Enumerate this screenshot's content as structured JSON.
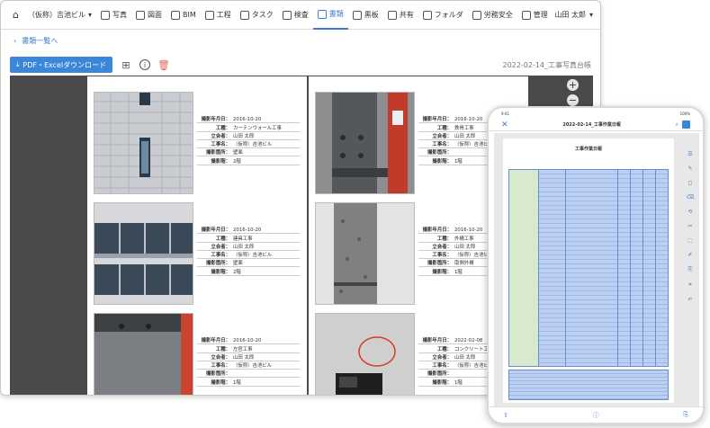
{
  "nav": {
    "project": "（仮称）吉池ビル",
    "items": [
      {
        "label": "写真"
      },
      {
        "label": "図面"
      },
      {
        "label": "BIM"
      },
      {
        "label": "工程"
      },
      {
        "label": "タスク"
      },
      {
        "label": "検査"
      },
      {
        "label": "書類"
      },
      {
        "label": "黒板"
      },
      {
        "label": "共有"
      },
      {
        "label": "フォルダ"
      },
      {
        "label": "労務安全"
      },
      {
        "label": "管理"
      }
    ],
    "user": "山田 太郎"
  },
  "breadcrumb": "書類一覧へ",
  "toolbar": {
    "download_label": "PDF・Excelダウンロード",
    "doc_title": "2022-02-14_工事写真台帳"
  },
  "entries_left": [
    {
      "date_k": "撮影年月日：",
      "date": "2016-10-20",
      "work_k": "工種：",
      "work": "カーテンウォール工事",
      "witness_k": "立会者：",
      "witness": "山田 太郎",
      "name_k": "工事名：",
      "name": "（仮称）吉池ビル",
      "place_k": "撮影箇所：",
      "place": "壁面",
      "floor_k": "撮影階：",
      "floor": "2階"
    },
    {
      "date_k": "撮影年月日：",
      "date": "2016-10-20",
      "work_k": "工種：",
      "work": "建具工事",
      "witness_k": "立会者：",
      "witness": "山田 太郎",
      "name_k": "工事名：",
      "name": "（仮称）吉池ビル",
      "place_k": "撮影箇所：",
      "place": "壁面",
      "floor_k": "撮影階：",
      "floor": "2階"
    },
    {
      "date_k": "撮影年月日：",
      "date": "2016-10-20",
      "work_k": "工種：",
      "work": "左官工事",
      "witness_k": "立会者：",
      "witness": "山田 太郎",
      "name_k": "工事名：",
      "name": "（仮称）吉池ビル",
      "place_k": "撮影箇所：",
      "place": "",
      "floor_k": "撮影階：",
      "floor": "1階"
    }
  ],
  "entries_right": [
    {
      "date_k": "撮影年月日：",
      "date": "2016-10-20",
      "work_k": "工種：",
      "work": "鉄骨工事",
      "witness_k": "立会者：",
      "witness": "山田 太郎",
      "name_k": "工事名：",
      "name": "（仮称）吉池ビル",
      "place_k": "撮影箇所：",
      "place": "",
      "floor_k": "撮影階：",
      "floor": "1階"
    },
    {
      "date_k": "撮影年月日：",
      "date": "2016-10-20",
      "work_k": "工種：",
      "work": "外構工事",
      "witness_k": "立会者：",
      "witness": "山田 太郎",
      "name_k": "工事名：",
      "name": "（仮称）吉池ビル",
      "place_k": "撮影箇所：",
      "place": "南側外構",
      "floor_k": "撮影階：",
      "floor": "1階"
    },
    {
      "date_k": "撮影年月日：",
      "date": "2022-02-08",
      "work_k": "工種：",
      "work": "コンクリート工事",
      "witness_k": "立会者：",
      "witness": "山田 太郎",
      "name_k": "工事名：",
      "name": "（仮称）吉池ビル",
      "place_k": "撮影箇所：",
      "place": "",
      "floor_k": "撮影階：",
      "floor": "1階"
    }
  ],
  "tablet": {
    "status_left": "9:41",
    "status_right": "100%",
    "close": "✕",
    "title": "2022-02-14_工事作業日報",
    "sheet_title": "工事作業日報",
    "tools": [
      "☰",
      "✎",
      "◻",
      "⌫",
      "⟲",
      "✂",
      "⬚",
      "✐",
      "⎘",
      "⌗",
      "↶"
    ],
    "foot_left": "⇧",
    "foot_mid": "ⓘ",
    "foot_right": "⎘"
  },
  "colors": {
    "accent": "#3a7bd5",
    "button": "#3a86d9",
    "viewer_bg": "#4a4a4a"
  }
}
